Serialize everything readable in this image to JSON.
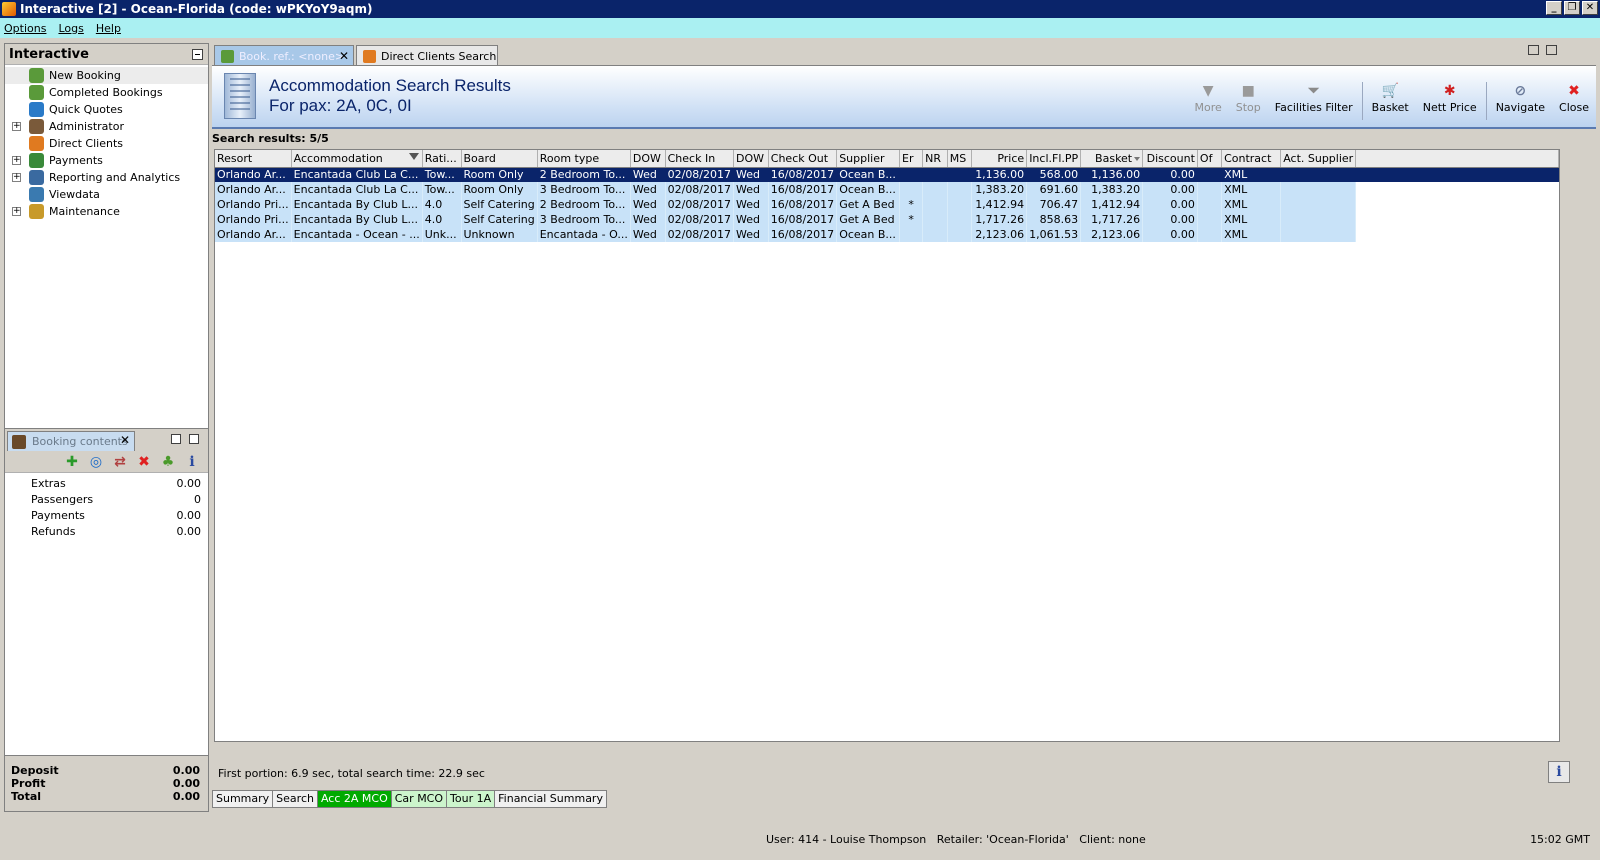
{
  "window": {
    "title": "Interactive [2] - Ocean-Florida (code: wPKYoY9aqm)"
  },
  "menu": [
    "Options",
    "Logs",
    "Help"
  ],
  "left_panel": {
    "header": "Interactive",
    "items": [
      {
        "label": "New Booking",
        "icon": "palm-tree-icon",
        "expandable": false,
        "selected": true
      },
      {
        "label": "Completed Bookings",
        "icon": "palm-tree-check-icon",
        "expandable": false
      },
      {
        "label": "Quick Quotes",
        "icon": "quote-clock-icon",
        "expandable": false
      },
      {
        "label": "Administrator",
        "icon": "admin-person-icon",
        "expandable": true
      },
      {
        "label": "Direct Clients",
        "icon": "direct-clients-icon",
        "expandable": false
      },
      {
        "label": "Payments",
        "icon": "payments-icon",
        "expandable": true
      },
      {
        "label": "Reporting and Analytics",
        "icon": "reporting-icon",
        "expandable": true
      },
      {
        "label": "Viewdata",
        "icon": "viewdata-globe-icon",
        "expandable": false
      },
      {
        "label": "Maintenance",
        "icon": "maintenance-box-icon",
        "expandable": true
      }
    ]
  },
  "booking_contents": {
    "tab_label": "Booking contents",
    "rows": [
      {
        "label": "Extras",
        "value": "0.00"
      },
      {
        "label": "Passengers",
        "value": "0"
      },
      {
        "label": "Payments",
        "value": "0.00"
      },
      {
        "label": "Refunds",
        "value": "0.00"
      }
    ],
    "footer": [
      {
        "label": "Deposit",
        "value": "0.00"
      },
      {
        "label": "Profit",
        "value": "0.00"
      },
      {
        "label": "Total",
        "value": "0.00"
      }
    ],
    "tools": [
      "add-icon",
      "refresh-icon",
      "transfer-icon",
      "delete-icon",
      "palm-tree-icon",
      "info-icon"
    ]
  },
  "tabs": [
    {
      "label": "Book. ref.: <none>",
      "active": true
    },
    {
      "label": "Direct Clients Search",
      "active": false
    }
  ],
  "results_header": {
    "title": "Accommodation Search Results",
    "subtitle": "For pax: 2A, 0C, 0I"
  },
  "toolbar": [
    {
      "label": "More",
      "icon": "more-arrow-icon",
      "disabled": true
    },
    {
      "label": "Stop",
      "icon": "stop-icon",
      "disabled": true
    },
    {
      "label": "Facilities Filter",
      "icon": "filter-funnel-icon",
      "disabled": false
    },
    {
      "label": "Basket",
      "icon": "basket-icon",
      "disabled": false,
      "sep_before": true
    },
    {
      "label": "Nett Price",
      "icon": "nett-price-icon",
      "disabled": false
    },
    {
      "label": "Navigate",
      "icon": "navigate-icon",
      "disabled": false,
      "sep_before": true
    },
    {
      "label": "Close",
      "icon": "close-icon",
      "disabled": false
    }
  ],
  "search_results": {
    "count_label": "Search results: 5/5",
    "columns": [
      "Resort",
      "Accommodation",
      "Rati...",
      "Board",
      "Room type",
      "DOW",
      "Check In",
      "DOW",
      "Check Out",
      "Supplier",
      "Er",
      "NR",
      "MS",
      "Price",
      "Incl.Fl.PP",
      "Basket",
      "Discount",
      "Of",
      "Contract",
      "Act. Supplier"
    ],
    "rows": [
      [
        "Orlando Ar...",
        "Encantada Club La C...",
        "Tow...",
        "Room Only",
        "2 Bedroom To...",
        "Wed",
        "02/08/2017",
        "Wed",
        "16/08/2017",
        "Ocean B...",
        "",
        "",
        "",
        "1,136.00",
        "568.00",
        "1,136.00",
        "0.00",
        "",
        "XML",
        ""
      ],
      [
        "Orlando Ar...",
        "Encantada Club La C...",
        "Tow...",
        "Room Only",
        "3 Bedroom To...",
        "Wed",
        "02/08/2017",
        "Wed",
        "16/08/2017",
        "Ocean B...",
        "",
        "",
        "",
        "1,383.20",
        "691.60",
        "1,383.20",
        "0.00",
        "",
        "XML",
        ""
      ],
      [
        "Orlando Pri...",
        "Encantada By Club L...",
        "4.0",
        "Self Catering",
        "2 Bedroom To...",
        "Wed",
        "02/08/2017",
        "Wed",
        "16/08/2017",
        "Get A Bed",
        "*",
        "",
        "",
        "1,412.94",
        "706.47",
        "1,412.94",
        "0.00",
        "",
        "XML",
        ""
      ],
      [
        "Orlando Pri...",
        "Encantada By Club L...",
        "4.0",
        "Self Catering",
        "3 Bedroom To...",
        "Wed",
        "02/08/2017",
        "Wed",
        "16/08/2017",
        "Get A Bed",
        "*",
        "",
        "",
        "1,717.26",
        "858.63",
        "1,717.26",
        "0.00",
        "",
        "XML",
        ""
      ],
      [
        "Orlando Ar...",
        "Encantada - Ocean - ...",
        "Unk...",
        "Unknown",
        "Encantada - O...",
        "Wed",
        "02/08/2017",
        "Wed",
        "16/08/2017",
        "Ocean B...",
        "",
        "",
        "",
        "2,123.06",
        "1,061.53",
        "2,123.06",
        "0.00",
        "",
        "XML",
        ""
      ]
    ],
    "selected_row": 0
  },
  "search_time": "First portion: 6.9 sec, total search time: 22.9 sec",
  "bottom_tabs": [
    {
      "label": "Summary",
      "style": "plain"
    },
    {
      "label": "Search",
      "style": "plain"
    },
    {
      "label": "Acc 2A MCO",
      "style": "green"
    },
    {
      "label": "Car MCO",
      "style": "lightgreen"
    },
    {
      "label": "Tour 1A",
      "style": "lightgreen"
    },
    {
      "label": "Financial Summary",
      "style": "plain"
    }
  ],
  "status": {
    "user_info": "User: 414 - Louise Thompson   Retailer: 'Ocean-Florida'   Client: none",
    "time": "15:02 GMT"
  },
  "colors": {
    "title_bar": "#0a246a",
    "menu_bar": "#aaf0f2",
    "row_fill": "#c8e2f8",
    "selected_row": "#0a246a",
    "green_tab": "#00aa00",
    "header_text": "#0a246a"
  }
}
